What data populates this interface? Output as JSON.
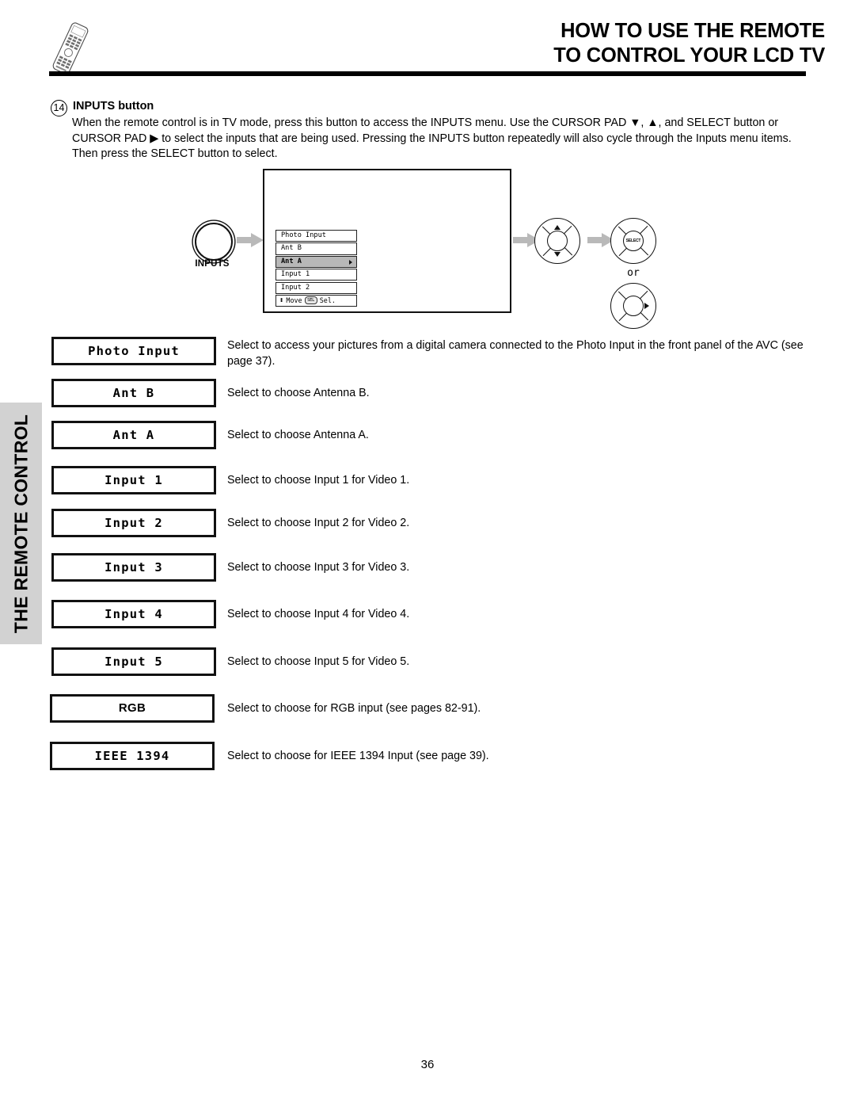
{
  "header": {
    "title_line1": "HOW TO USE THE REMOTE",
    "title_line2": "TO CONTROL YOUR LCD TV",
    "remote_icon": "remote-control-icon"
  },
  "intro": {
    "number": "14",
    "heading": "INPUTS button",
    "body": "When the remote control is in TV mode, press this button to access the INPUTS menu.  Use the CURSOR PAD ▼, ▲, and SELECT button or CURSOR PAD ▶ to select the inputs that are being used.  Pressing the INPUTS button repeatedly will also cycle through the Inputs menu items.  Then press the SELECT button to select."
  },
  "diagram": {
    "inputs_button_label": "INPUTS",
    "or_label": "or",
    "select_hub_label": "SELECT",
    "osd_items": [
      {
        "label": "Photo Input",
        "selected": false,
        "submenu": false
      },
      {
        "label": "Ant B",
        "selected": false,
        "submenu": false
      },
      {
        "label": "Ant A",
        "selected": true,
        "submenu": true
      },
      {
        "label": "Input 1",
        "selected": false,
        "submenu": false
      },
      {
        "label": "Input 2",
        "selected": false,
        "submenu": false
      }
    ],
    "osd_footer": {
      "move_glyph": "↕",
      "move_label": "Move",
      "sel_chip": "SEL",
      "sel_label": "Sel."
    }
  },
  "side_tab": {
    "label": "THE REMOTE CONTROL"
  },
  "table": {
    "rows": [
      {
        "key": "Photo Input",
        "key_font": "mono",
        "desc": "Select to access your pictures from a digital camera connected to the Photo Input in the front panel of the AVC (see page 37)."
      },
      {
        "key": "Ant B",
        "key_font": "mono",
        "desc": "Select to choose Antenna B."
      },
      {
        "key": "Ant A",
        "key_font": "mono",
        "desc": "Select to choose Antenna A."
      },
      {
        "key": "Input 1",
        "key_font": "mono",
        "desc": "Select to choose Input 1 for Video 1."
      },
      {
        "key": "Input 2",
        "key_font": "mono",
        "desc": "Select to choose Input 2 for Video 2."
      },
      {
        "key": "Input 3",
        "key_font": "mono",
        "desc": "Select to choose Input 3 for Video 3."
      },
      {
        "key": "Input 4",
        "key_font": "mono",
        "desc": "Select to choose Input 4 for Video 4."
      },
      {
        "key": "Input 5",
        "key_font": "mono",
        "desc": "Select to choose Input 5 for Video 5."
      },
      {
        "key": "RGB",
        "key_font": "sans",
        "desc": "Select to choose for RGB input (see pages 82-91)."
      },
      {
        "key": "IEEE 1394",
        "key_font": "mono",
        "desc": "Select to choose for IEEE 1394 Input (see page 39)."
      }
    ]
  },
  "footer": {
    "page_number": "36"
  }
}
